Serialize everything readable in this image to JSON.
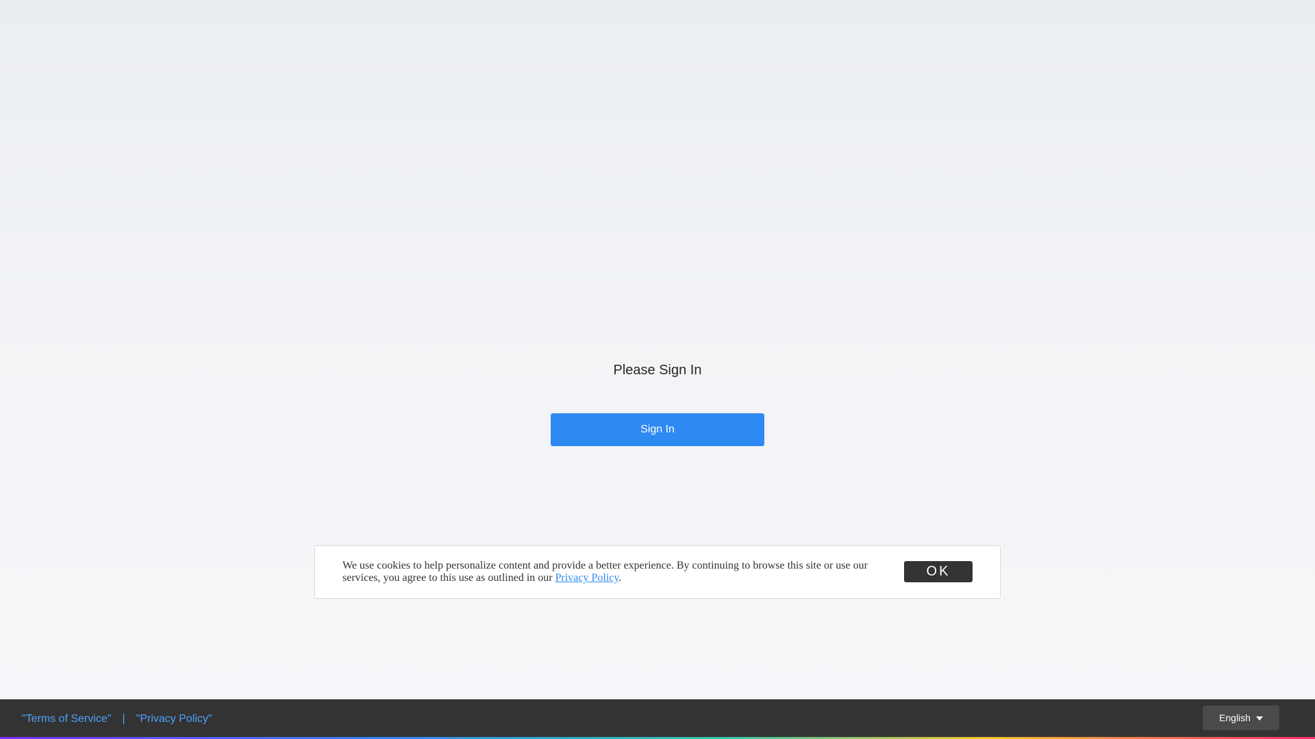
{
  "signin": {
    "title": "Please Sign In",
    "button_label": "Sign In"
  },
  "cookie_banner": {
    "text": "We use cookies to help personalize content and provide a better experience. By continuing to browse this site or use our services, you agree to this use as outlined in our ",
    "link_label": "Privacy Policy",
    "text_end": ".",
    "ok_label": "OK"
  },
  "footer": {
    "terms_label": "\"Terms of Service\"",
    "separator": "|",
    "privacy_label": "\"Privacy Policy\"",
    "language": "English",
    "language_icon": "chevron-down-icon"
  },
  "colors": {
    "primary": "#2f89f2",
    "footer_bg": "#333333",
    "link": "#4da3ff"
  }
}
